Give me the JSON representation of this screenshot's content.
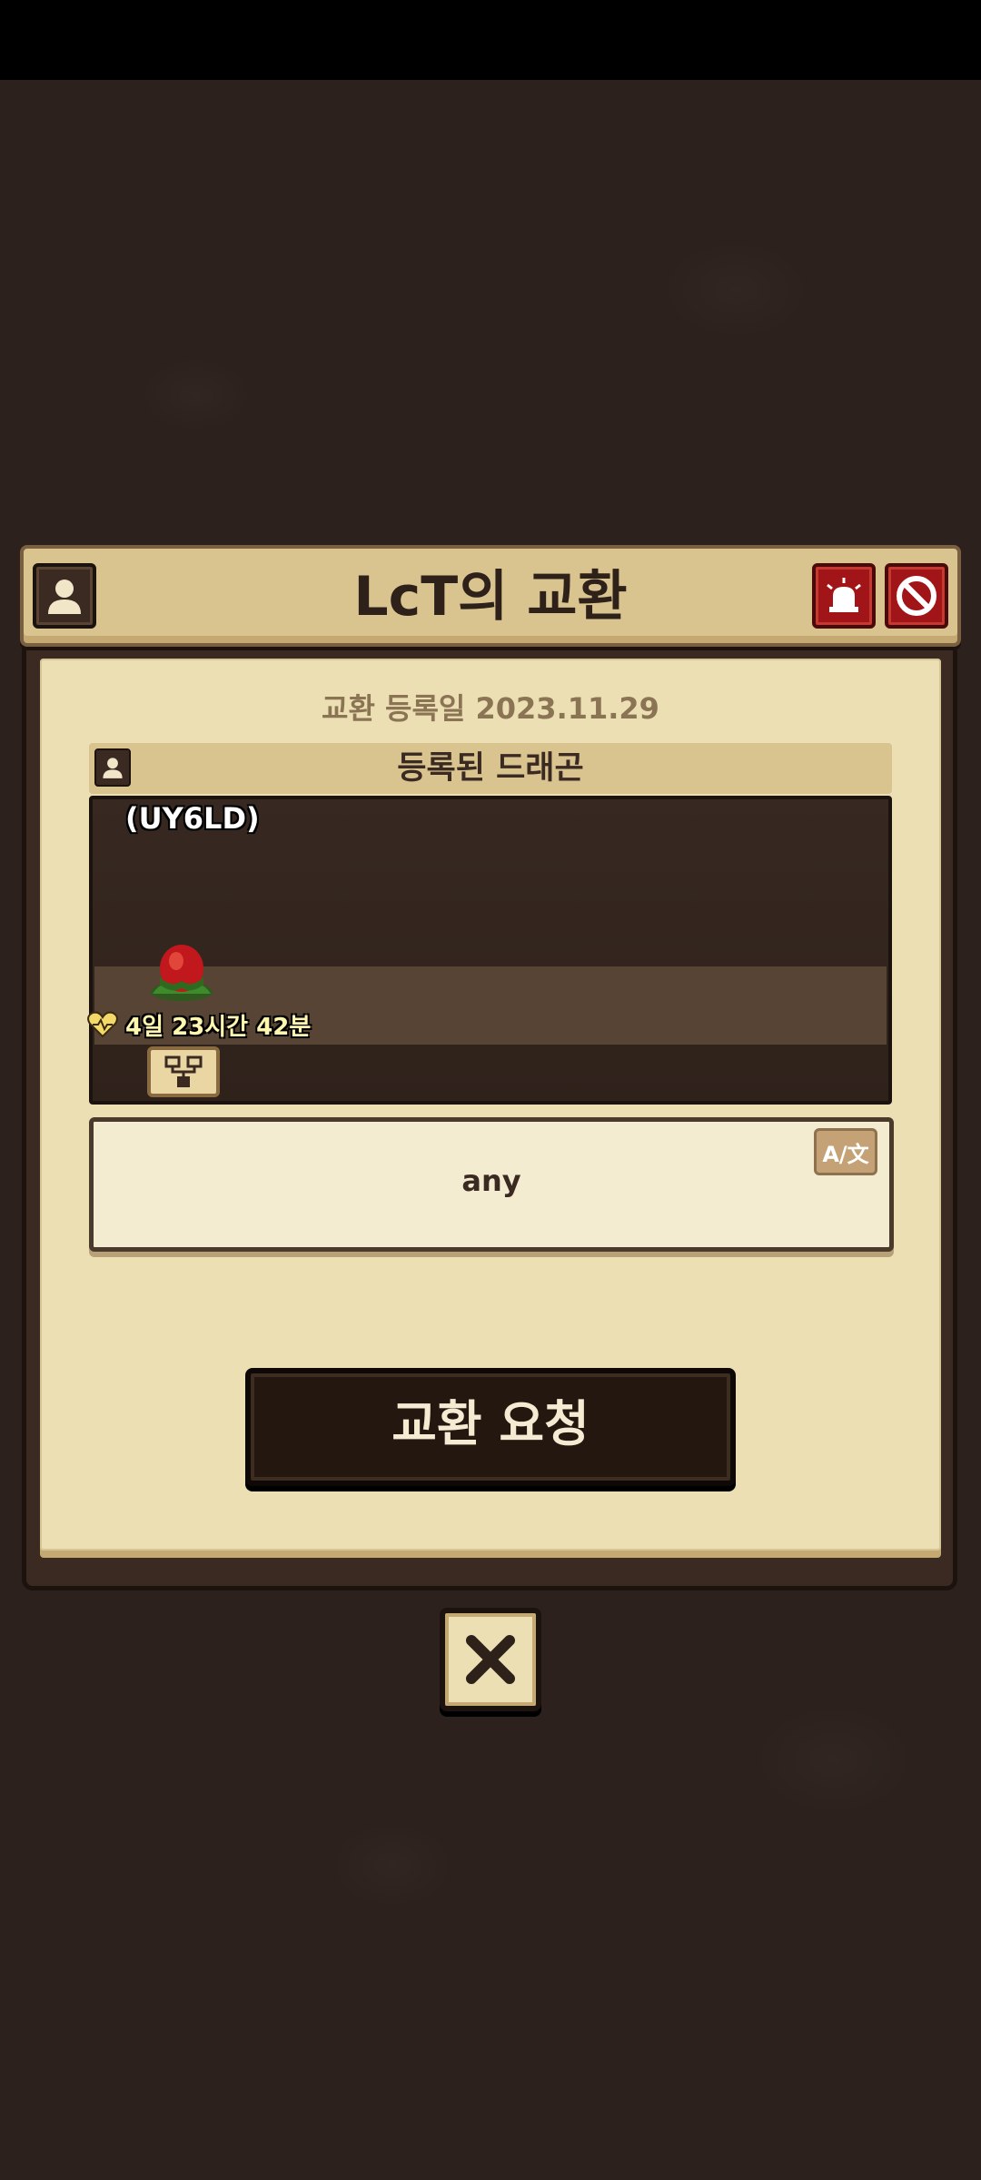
{
  "dialog": {
    "title": "LcT의 교환",
    "registered_date": "교환 등록일 2023.11.29",
    "section_title": "등록된 드래곤",
    "dragon": {
      "name": "(UY6LD)",
      "timer": "4일 23시간 42분"
    },
    "message": "any",
    "translate_icon": "A/文",
    "trade_button": "교환 요청"
  },
  "icons": {
    "profile": "person-icon",
    "report": "siren-icon",
    "block": "block-icon",
    "family": "family-tree-icon",
    "close": "close-icon",
    "heart": "heart-icon",
    "egg": "dragon-egg-icon"
  },
  "colors": {
    "background": "#2c211c",
    "paper": "#ecdfb4",
    "header": "#d9c38f",
    "danger": "#a11418",
    "timer": "#fff6b0"
  }
}
